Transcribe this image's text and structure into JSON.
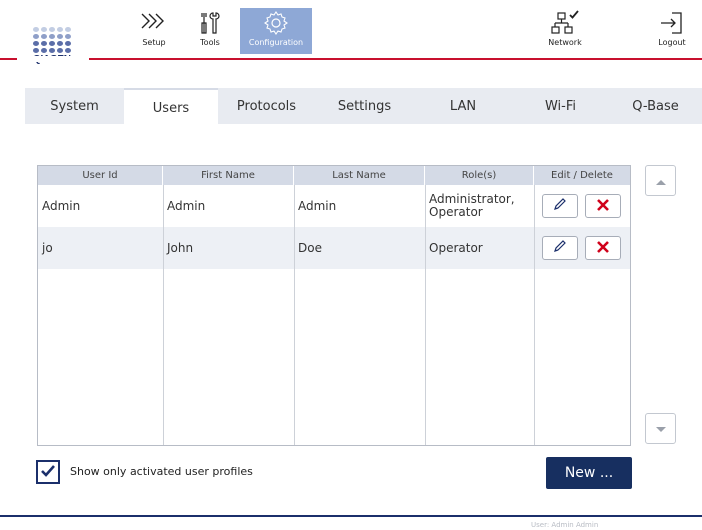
{
  "header": {
    "logo_text": "QIAGEN",
    "nav": {
      "setup": "Setup",
      "tools": "Tools",
      "configuration": "Configuration",
      "network": "Network",
      "logout": "Logout"
    }
  },
  "tabs": [
    {
      "label": "System"
    },
    {
      "label": "Users"
    },
    {
      "label": "Protocols"
    },
    {
      "label": "Settings"
    },
    {
      "label": "LAN"
    },
    {
      "label": "Wi-Fi"
    },
    {
      "label": "Q-Base"
    }
  ],
  "active_tab": "Users",
  "table": {
    "headers": [
      "User Id",
      "First Name",
      "Last Name",
      "Role(s)",
      "Edit / Delete"
    ],
    "rows": [
      {
        "user_id": "Admin",
        "first_name": "Admin",
        "last_name": "Admin",
        "roles": "Administrator, Operator"
      },
      {
        "user_id": "jo",
        "first_name": "John",
        "last_name": "Doe",
        "roles": "Operator"
      }
    ]
  },
  "filter": {
    "show_activated_label": "Show only activated user profiles",
    "checked": true
  },
  "new_button": "New ...",
  "status": "User: Admin Admin",
  "colors": {
    "accent_red": "#c8102e",
    "brand_navy": "#1b2f6b",
    "header_active": "#8ea8d6",
    "delete_x": "#d0021b"
  }
}
